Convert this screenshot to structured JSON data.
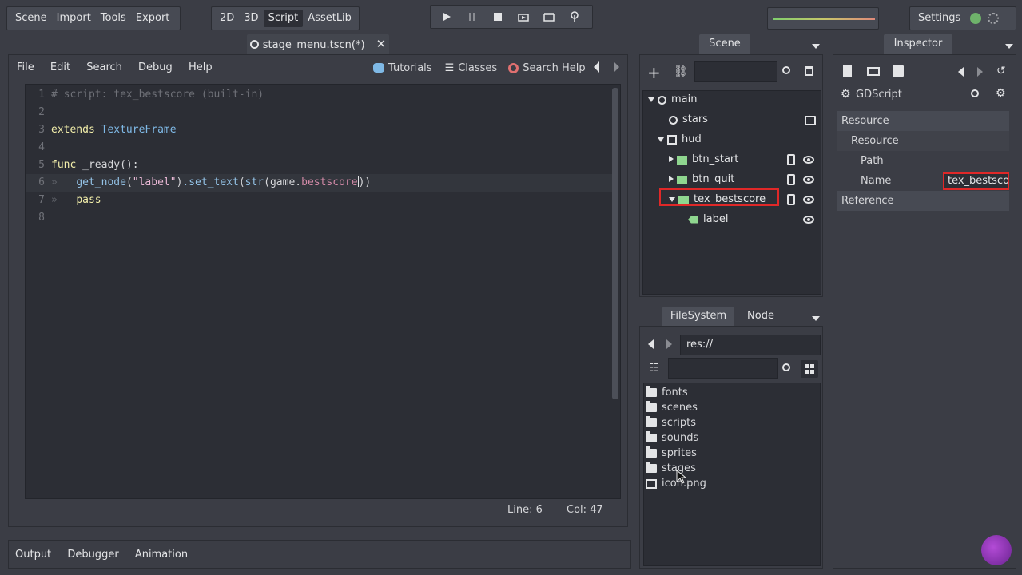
{
  "top_menu": [
    "Scene",
    "Import",
    "Tools",
    "Export"
  ],
  "view_modes": {
    "items": [
      "2D",
      "3D",
      "Script",
      "AssetLib"
    ],
    "active": "Script"
  },
  "play_controls": [
    "play",
    "pause",
    "stop",
    "play-scene",
    "play-custom",
    "remote-debug"
  ],
  "settings_label": "Settings",
  "editor_tab": {
    "label": "stage_menu.tscn(*)"
  },
  "script_editor": {
    "menu": [
      "File",
      "Edit",
      "Search",
      "Debug",
      "Help"
    ],
    "help_buttons": {
      "tutorials": "Tutorials",
      "classes": "Classes",
      "search_help": "Search Help"
    },
    "lines": [
      {
        "n": "1",
        "text": "# script: tex_bestscore (built-in)"
      },
      {
        "n": "2",
        "text": ""
      },
      {
        "n": "3",
        "kw": "extends",
        "type": "TextureFrame"
      },
      {
        "n": "4",
        "text": ""
      },
      {
        "n": "5",
        "kw": "func",
        "name": "_ready():"
      },
      {
        "n": "6",
        "fn1": "get_node",
        "str": "\"label\"",
        "fn2": ".set_text",
        "fn3": "str",
        "obj": "game.",
        "var": "bestscore",
        "end": "))"
      },
      {
        "n": "7",
        "kw": "pass"
      },
      {
        "n": "8",
        "text": ""
      }
    ],
    "status": {
      "line": "Line: 6",
      "col": "Col: 47"
    }
  },
  "scene_panel": {
    "title": "Scene",
    "tree": [
      {
        "label": "main",
        "depth": 0
      },
      {
        "label": "stars",
        "depth": 1
      },
      {
        "label": "hud",
        "depth": 1
      },
      {
        "label": "btn_start",
        "depth": 2
      },
      {
        "label": "btn_quit",
        "depth": 2
      },
      {
        "label": "tex_bestscore",
        "depth": 2,
        "selected": true
      },
      {
        "label": "label",
        "depth": 3
      }
    ]
  },
  "filesystem": {
    "tabs": [
      "FileSystem",
      "Node"
    ],
    "active_tab": "FileSystem",
    "path": "res://",
    "items": [
      {
        "label": "fonts",
        "type": "folder"
      },
      {
        "label": "scenes",
        "type": "folder"
      },
      {
        "label": "scripts",
        "type": "folder"
      },
      {
        "label": "sounds",
        "type": "folder"
      },
      {
        "label": "sprites",
        "type": "folder"
      },
      {
        "label": "stages",
        "type": "folder"
      },
      {
        "label": "icon.png",
        "type": "image"
      }
    ]
  },
  "inspector": {
    "title": "Inspector",
    "object_type": "GDScript",
    "sections": {
      "resource": "Resource",
      "resource_sub": "Resource",
      "path": "Path",
      "name": "Name",
      "reference": "Reference"
    },
    "name_value": "tex_bestscor"
  },
  "bottom_tabs": [
    "Output",
    "Debugger",
    "Animation"
  ],
  "colors": {
    "accent_red": "#e02828",
    "bg": "#3b3d45",
    "panel": "#2c2e35"
  }
}
